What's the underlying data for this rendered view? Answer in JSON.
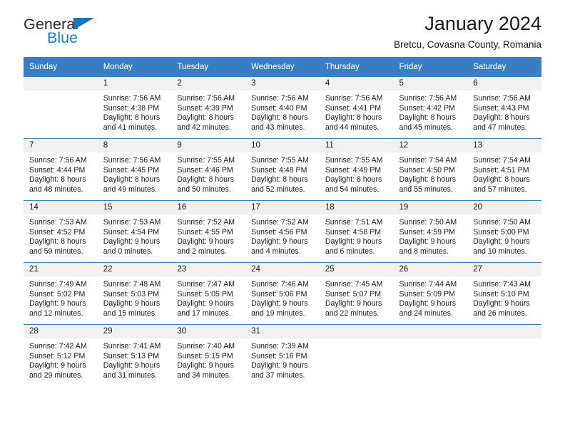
{
  "brand": {
    "name_part1": "General",
    "name_part2": "Blue",
    "triangle_color": "#1673bd",
    "blue_color": "#1a7fd4"
  },
  "header": {
    "title": "January 2024",
    "subtitle": "Bretcu, Covasna County, Romania"
  },
  "theme": {
    "header_band": "#3b7dc4",
    "daynum_band": "#f1f1f1",
    "row_divider": "#3b7dc4",
    "text": "#1a1a1a"
  },
  "weekday_headers": [
    "Sunday",
    "Monday",
    "Tuesday",
    "Wednesday",
    "Thursday",
    "Friday",
    "Saturday"
  ],
  "labels": {
    "sunrise_prefix": "Sunrise:",
    "sunset_prefix": "Sunset:",
    "daylight_prefix": "Daylight:"
  },
  "weeks": [
    [
      {
        "day": "",
        "sunrise": "",
        "sunset": "",
        "daylight_line1": "",
        "daylight_line2": ""
      },
      {
        "day": "1",
        "sunrise": "Sunrise: 7:56 AM",
        "sunset": "Sunset: 4:38 PM",
        "daylight_line1": "Daylight: 8 hours",
        "daylight_line2": "and 41 minutes."
      },
      {
        "day": "2",
        "sunrise": "Sunrise: 7:56 AM",
        "sunset": "Sunset: 4:39 PM",
        "daylight_line1": "Daylight: 8 hours",
        "daylight_line2": "and 42 minutes."
      },
      {
        "day": "3",
        "sunrise": "Sunrise: 7:56 AM",
        "sunset": "Sunset: 4:40 PM",
        "daylight_line1": "Daylight: 8 hours",
        "daylight_line2": "and 43 minutes."
      },
      {
        "day": "4",
        "sunrise": "Sunrise: 7:56 AM",
        "sunset": "Sunset: 4:41 PM",
        "daylight_line1": "Daylight: 8 hours",
        "daylight_line2": "and 44 minutes."
      },
      {
        "day": "5",
        "sunrise": "Sunrise: 7:56 AM",
        "sunset": "Sunset: 4:42 PM",
        "daylight_line1": "Daylight: 8 hours",
        "daylight_line2": "and 45 minutes."
      },
      {
        "day": "6",
        "sunrise": "Sunrise: 7:56 AM",
        "sunset": "Sunset: 4:43 PM",
        "daylight_line1": "Daylight: 8 hours",
        "daylight_line2": "and 47 minutes."
      }
    ],
    [
      {
        "day": "7",
        "sunrise": "Sunrise: 7:56 AM",
        "sunset": "Sunset: 4:44 PM",
        "daylight_line1": "Daylight: 8 hours",
        "daylight_line2": "and 48 minutes."
      },
      {
        "day": "8",
        "sunrise": "Sunrise: 7:56 AM",
        "sunset": "Sunset: 4:45 PM",
        "daylight_line1": "Daylight: 8 hours",
        "daylight_line2": "and 49 minutes."
      },
      {
        "day": "9",
        "sunrise": "Sunrise: 7:55 AM",
        "sunset": "Sunset: 4:46 PM",
        "daylight_line1": "Daylight: 8 hours",
        "daylight_line2": "and 50 minutes."
      },
      {
        "day": "10",
        "sunrise": "Sunrise: 7:55 AM",
        "sunset": "Sunset: 4:48 PM",
        "daylight_line1": "Daylight: 8 hours",
        "daylight_line2": "and 52 minutes."
      },
      {
        "day": "11",
        "sunrise": "Sunrise: 7:55 AM",
        "sunset": "Sunset: 4:49 PM",
        "daylight_line1": "Daylight: 8 hours",
        "daylight_line2": "and 54 minutes."
      },
      {
        "day": "12",
        "sunrise": "Sunrise: 7:54 AM",
        "sunset": "Sunset: 4:50 PM",
        "daylight_line1": "Daylight: 8 hours",
        "daylight_line2": "and 55 minutes."
      },
      {
        "day": "13",
        "sunrise": "Sunrise: 7:54 AM",
        "sunset": "Sunset: 4:51 PM",
        "daylight_line1": "Daylight: 8 hours",
        "daylight_line2": "and 57 minutes."
      }
    ],
    [
      {
        "day": "14",
        "sunrise": "Sunrise: 7:53 AM",
        "sunset": "Sunset: 4:52 PM",
        "daylight_line1": "Daylight: 8 hours",
        "daylight_line2": "and 59 minutes."
      },
      {
        "day": "15",
        "sunrise": "Sunrise: 7:53 AM",
        "sunset": "Sunset: 4:54 PM",
        "daylight_line1": "Daylight: 9 hours",
        "daylight_line2": "and 0 minutes."
      },
      {
        "day": "16",
        "sunrise": "Sunrise: 7:52 AM",
        "sunset": "Sunset: 4:55 PM",
        "daylight_line1": "Daylight: 9 hours",
        "daylight_line2": "and 2 minutes."
      },
      {
        "day": "17",
        "sunrise": "Sunrise: 7:52 AM",
        "sunset": "Sunset: 4:56 PM",
        "daylight_line1": "Daylight: 9 hours",
        "daylight_line2": "and 4 minutes."
      },
      {
        "day": "18",
        "sunrise": "Sunrise: 7:51 AM",
        "sunset": "Sunset: 4:58 PM",
        "daylight_line1": "Daylight: 9 hours",
        "daylight_line2": "and 6 minutes."
      },
      {
        "day": "19",
        "sunrise": "Sunrise: 7:50 AM",
        "sunset": "Sunset: 4:59 PM",
        "daylight_line1": "Daylight: 9 hours",
        "daylight_line2": "and 8 minutes."
      },
      {
        "day": "20",
        "sunrise": "Sunrise: 7:50 AM",
        "sunset": "Sunset: 5:00 PM",
        "daylight_line1": "Daylight: 9 hours",
        "daylight_line2": "and 10 minutes."
      }
    ],
    [
      {
        "day": "21",
        "sunrise": "Sunrise: 7:49 AM",
        "sunset": "Sunset: 5:02 PM",
        "daylight_line1": "Daylight: 9 hours",
        "daylight_line2": "and 12 minutes."
      },
      {
        "day": "22",
        "sunrise": "Sunrise: 7:48 AM",
        "sunset": "Sunset: 5:03 PM",
        "daylight_line1": "Daylight: 9 hours",
        "daylight_line2": "and 15 minutes."
      },
      {
        "day": "23",
        "sunrise": "Sunrise: 7:47 AM",
        "sunset": "Sunset: 5:05 PM",
        "daylight_line1": "Daylight: 9 hours",
        "daylight_line2": "and 17 minutes."
      },
      {
        "day": "24",
        "sunrise": "Sunrise: 7:46 AM",
        "sunset": "Sunset: 5:06 PM",
        "daylight_line1": "Daylight: 9 hours",
        "daylight_line2": "and 19 minutes."
      },
      {
        "day": "25",
        "sunrise": "Sunrise: 7:45 AM",
        "sunset": "Sunset: 5:07 PM",
        "daylight_line1": "Daylight: 9 hours",
        "daylight_line2": "and 22 minutes."
      },
      {
        "day": "26",
        "sunrise": "Sunrise: 7:44 AM",
        "sunset": "Sunset: 5:09 PM",
        "daylight_line1": "Daylight: 9 hours",
        "daylight_line2": "and 24 minutes."
      },
      {
        "day": "27",
        "sunrise": "Sunrise: 7:43 AM",
        "sunset": "Sunset: 5:10 PM",
        "daylight_line1": "Daylight: 9 hours",
        "daylight_line2": "and 26 minutes."
      }
    ],
    [
      {
        "day": "28",
        "sunrise": "Sunrise: 7:42 AM",
        "sunset": "Sunset: 5:12 PM",
        "daylight_line1": "Daylight: 9 hours",
        "daylight_line2": "and 29 minutes."
      },
      {
        "day": "29",
        "sunrise": "Sunrise: 7:41 AM",
        "sunset": "Sunset: 5:13 PM",
        "daylight_line1": "Daylight: 9 hours",
        "daylight_line2": "and 31 minutes."
      },
      {
        "day": "30",
        "sunrise": "Sunrise: 7:40 AM",
        "sunset": "Sunset: 5:15 PM",
        "daylight_line1": "Daylight: 9 hours",
        "daylight_line2": "and 34 minutes."
      },
      {
        "day": "31",
        "sunrise": "Sunrise: 7:39 AM",
        "sunset": "Sunset: 5:16 PM",
        "daylight_line1": "Daylight: 9 hours",
        "daylight_line2": "and 37 minutes."
      },
      {
        "day": "",
        "sunrise": "",
        "sunset": "",
        "daylight_line1": "",
        "daylight_line2": ""
      },
      {
        "day": "",
        "sunrise": "",
        "sunset": "",
        "daylight_line1": "",
        "daylight_line2": ""
      },
      {
        "day": "",
        "sunrise": "",
        "sunset": "",
        "daylight_line1": "",
        "daylight_line2": ""
      }
    ]
  ]
}
